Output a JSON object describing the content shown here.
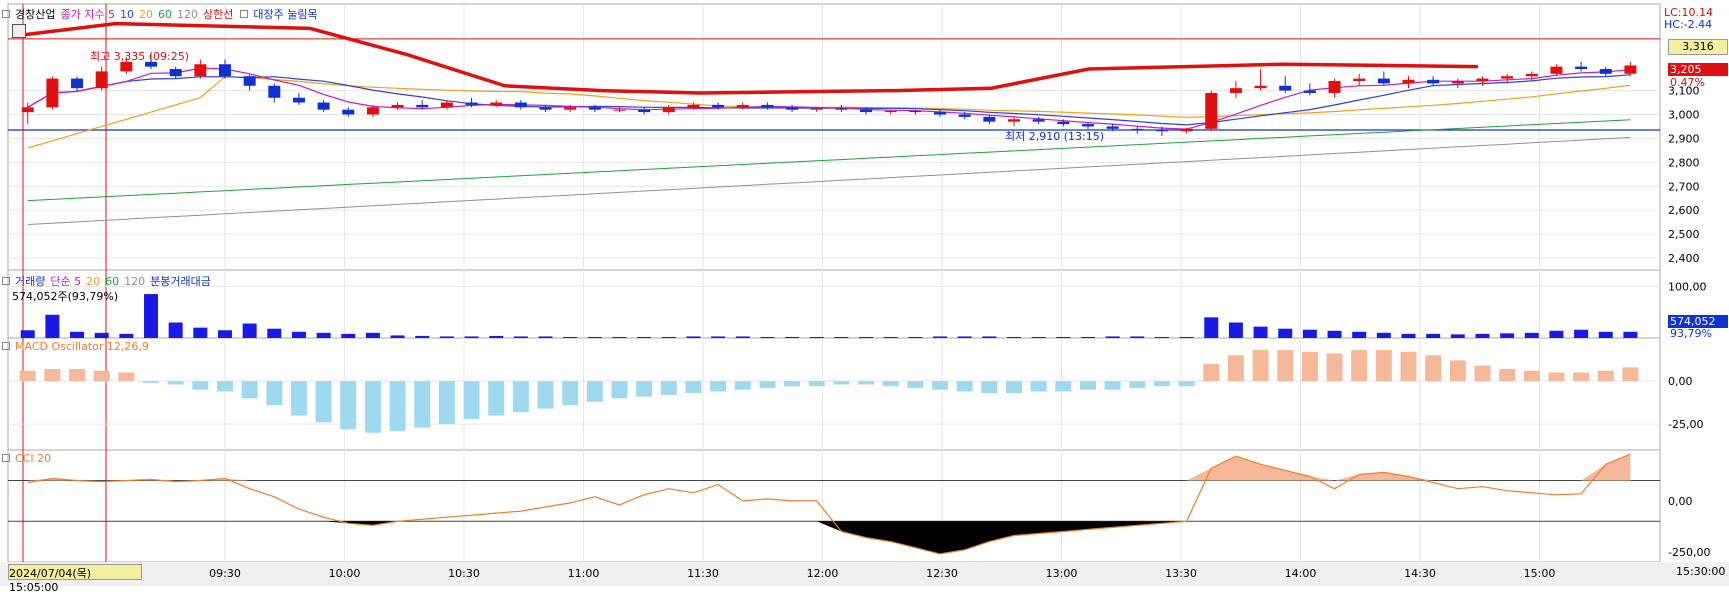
{
  "colors": {
    "price_line": "#e01010",
    "ma5": "#c020c0",
    "ma10": "#3040d0",
    "ma20": "#f0a020",
    "ma60": "#20a040",
    "ma120": "#909090",
    "up": "#e01010",
    "down": "#1030d0",
    "macd_pos": "#f5b99a",
    "macd_neg": "#9fd9f0",
    "cci": "#ef7d2f",
    "highlight": "#f5f0a0"
  },
  "legends": {
    "price": [
      {
        "text": "경창산업",
        "color": "#000000",
        "box": true
      },
      {
        "text": "종가 지수 5",
        "color": "#c020c0"
      },
      {
        "text": "10",
        "color": "#3040d0"
      },
      {
        "text": "20",
        "color": "#f0a020"
      },
      {
        "text": "60",
        "color": "#20a040"
      },
      {
        "text": "120",
        "color": "#909090"
      },
      {
        "text": "상한선",
        "color": "#e01010"
      },
      {
        "text": "대장주 눌림목",
        "color": "#1030d0",
        "box": true
      }
    ],
    "volume": [
      {
        "text": "거래량",
        "color": "#1030d0",
        "box": true
      },
      {
        "text": "단순 5",
        "color": "#c020c0"
      },
      {
        "text": "20",
        "color": "#f0a020"
      },
      {
        "text": "60",
        "color": "#20a040"
      },
      {
        "text": "120",
        "color": "#909090"
      },
      {
        "text": "분봉거래대금",
        "color": "#1030d0"
      }
    ],
    "macd": [
      {
        "text": "MACD Oscillator 12,26,9",
        "color": "#ef7d2f",
        "box": true
      }
    ],
    "cci": [
      {
        "text": "CCI 20",
        "color": "#ef7d2f",
        "box": true
      }
    ]
  },
  "labels": {
    "volume_info": "574,052주(93,79%)",
    "high_annotation": "최고 3,335 (09:25)",
    "low_annotation": "최저 2,910 (13:15)",
    "lc": "LC:10.14",
    "hc": "HC:-2.44",
    "price_box_1": "3,316",
    "price_box_2": "3,205",
    "price_pct": "0.47%",
    "vol_box": "574,052",
    "vol_pct": "93,79%",
    "date_box": "2024/07/04(목) 15:05:00",
    "end_time": "15:30:00"
  },
  "chart_data": {
    "type": "candlestick",
    "x_ticks": [
      "09:30",
      "10:00",
      "10:30",
      "11:00",
      "11:30",
      "12:00",
      "12:30",
      "13:00",
      "13:30",
      "14:00",
      "14:30",
      "15:00"
    ],
    "price_axis": {
      "ticks": [
        "3,100",
        "3,000",
        "2,900",
        "2,800",
        "2,700",
        "2,600",
        "2,500",
        "2,400"
      ],
      "ylim": [
        2350,
        3420
      ]
    },
    "candles": [
      [
        3010,
        3050,
        2960,
        3030
      ],
      [
        3030,
        3160,
        3020,
        3150
      ],
      [
        3150,
        3160,
        3100,
        3110
      ],
      [
        3110,
        3200,
        3100,
        3180
      ],
      [
        3180,
        3240,
        3170,
        3220
      ],
      [
        3220,
        3250,
        3190,
        3200
      ],
      [
        3190,
        3200,
        3150,
        3160
      ],
      [
        3160,
        3230,
        3150,
        3210
      ],
      [
        3210,
        3230,
        3150,
        3160
      ],
      [
        3160,
        3170,
        3100,
        3120
      ],
      [
        3120,
        3130,
        3050,
        3070
      ],
      [
        3070,
        3090,
        3040,
        3050
      ],
      [
        3050,
        3060,
        3010,
        3020
      ],
      [
        3020,
        3030,
        2990,
        3000
      ],
      [
        3000,
        3040,
        2990,
        3030
      ],
      [
        3030,
        3050,
        3020,
        3040
      ],
      [
        3040,
        3060,
        3020,
        3030
      ],
      [
        3030,
        3060,
        3020,
        3050
      ],
      [
        3050,
        3070,
        3030,
        3040
      ],
      [
        3040,
        3060,
        3030,
        3050
      ],
      [
        3050,
        3060,
        3020,
        3030
      ],
      [
        3030,
        3040,
        3010,
        3020
      ],
      [
        3020,
        3040,
        3010,
        3030
      ],
      [
        3030,
        3040,
        3010,
        3020
      ],
      [
        3020,
        3030,
        3010,
        3020
      ],
      [
        3020,
        3030,
        3000,
        3010
      ],
      [
        3010,
        3040,
        3000,
        3030
      ],
      [
        3030,
        3050,
        3020,
        3040
      ],
      [
        3040,
        3050,
        3020,
        3030
      ],
      [
        3030,
        3050,
        3020,
        3040
      ],
      [
        3040,
        3050,
        3020,
        3030
      ],
      [
        3030,
        3040,
        3010,
        3020
      ],
      [
        3020,
        3030,
        3010,
        3025
      ],
      [
        3025,
        3040,
        3010,
        3020
      ],
      [
        3020,
        3030,
        3000,
        3010
      ],
      [
        3010,
        3020,
        3000,
        3015
      ],
      [
        3015,
        3020,
        3000,
        3010
      ],
      [
        3010,
        3020,
        2990,
        3000
      ],
      [
        3000,
        3010,
        2980,
        2990
      ],
      [
        2990,
        3000,
        2960,
        2970
      ],
      [
        2970,
        2990,
        2950,
        2980
      ],
      [
        2980,
        2990,
        2960,
        2970
      ],
      [
        2970,
        2980,
        2950,
        2960
      ],
      [
        2960,
        2970,
        2940,
        2950
      ],
      [
        2950,
        2960,
        2930,
        2940
      ],
      [
        2940,
        2950,
        2920,
        2935
      ],
      [
        2935,
        2950,
        2910,
        2930
      ],
      [
        2930,
        2945,
        2920,
        2940
      ],
      [
        2940,
        3100,
        2930,
        3090
      ],
      [
        3090,
        3140,
        3070,
        3110
      ],
      [
        3110,
        3190,
        3100,
        3120
      ],
      [
        3120,
        3160,
        3090,
        3100
      ],
      [
        3100,
        3130,
        3080,
        3090
      ],
      [
        3090,
        3150,
        3070,
        3140
      ],
      [
        3140,
        3170,
        3120,
        3150
      ],
      [
        3150,
        3180,
        3120,
        3130
      ],
      [
        3130,
        3160,
        3110,
        3145
      ],
      [
        3145,
        3160,
        3120,
        3130
      ],
      [
        3130,
        3150,
        3110,
        3140
      ],
      [
        3140,
        3160,
        3120,
        3150
      ],
      [
        3150,
        3170,
        3130,
        3160
      ],
      [
        3160,
        3180,
        3140,
        3170
      ],
      [
        3170,
        3210,
        3160,
        3200
      ],
      [
        3200,
        3220,
        3180,
        3190
      ],
      [
        3190,
        3200,
        3160,
        3170
      ],
      [
        3170,
        3220,
        3160,
        3205
      ]
    ],
    "upper_limit_line": [
      3330,
      3380,
      3370,
      3360,
      3250,
      3120,
      3100,
      3090,
      3095,
      3100,
      3110,
      3190,
      3200,
      3210,
      3205,
      3200
    ],
    "volume_axis": {
      "ticks": [
        "100,00"
      ],
      "max": 120
    },
    "volume": [
      15,
      45,
      12,
      10,
      8,
      85,
      30,
      20,
      15,
      28,
      18,
      12,
      10,
      8,
      10,
      5,
      4,
      3,
      3,
      4,
      3,
      3,
      2,
      2,
      2,
      2,
      2,
      3,
      3,
      3,
      2,
      2,
      2,
      2,
      2,
      2,
      2,
      3,
      3,
      3,
      2,
      2,
      2,
      2,
      3,
      3,
      2,
      2,
      40,
      30,
      22,
      18,
      16,
      14,
      12,
      10,
      8,
      8,
      7,
      8,
      9,
      10,
      14,
      16,
      12,
      12
    ],
    "macd_axis": {
      "ticks": [
        "0,00",
        "-25,00"
      ],
      "ylim": [
        -40,
        25
      ]
    },
    "macd": [
      6,
      7,
      7,
      6,
      5,
      -1,
      -2,
      -5,
      -6,
      -10,
      -14,
      -20,
      -24,
      -28,
      -30,
      -29,
      -27,
      -25,
      -22,
      -20,
      -18,
      -16,
      -14,
      -12,
      -10,
      -9,
      -8,
      -7,
      -6,
      -5,
      -4,
      -3,
      -3,
      -2,
      -2,
      -3,
      -4,
      -5,
      -6,
      -7,
      -7,
      -6,
      -6,
      -5,
      -5,
      -4,
      -3,
      -3,
      10,
      15,
      18,
      18,
      17,
      16,
      18,
      18,
      17,
      15,
      12,
      9,
      7,
      6,
      5,
      5,
      6,
      8
    ],
    "cci_axis": {
      "ticks": [
        "0,00",
        "-250,00"
      ],
      "ylim": [
        -300,
        250
      ]
    },
    "cci": [
      90,
      110,
      100,
      95,
      100,
      105,
      95,
      100,
      110,
      60,
      20,
      -40,
      -80,
      -110,
      -120,
      -100,
      -90,
      -80,
      -70,
      -60,
      -50,
      -30,
      -10,
      20,
      -20,
      30,
      60,
      40,
      80,
      0,
      10,
      0,
      0,
      -150,
      -180,
      -200,
      -230,
      -260,
      -240,
      -200,
      -170,
      -160,
      -150,
      -140,
      -130,
      -120,
      -110,
      -100,
      160,
      220,
      180,
      150,
      120,
      60,
      130,
      140,
      120,
      90,
      60,
      70,
      50,
      40,
      30,
      35,
      180,
      230
    ]
  }
}
